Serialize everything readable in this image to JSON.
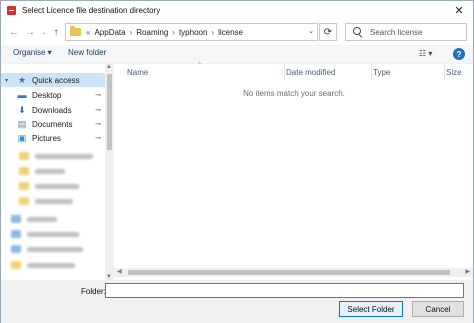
{
  "window": {
    "title": "Select Licence file destination directory",
    "close_glyph": "✕",
    "accent": "#d8302f"
  },
  "nav": {
    "back": "←",
    "forward": "→",
    "up": "↑",
    "refresh": "⟳",
    "overflow": "«",
    "breadcrumbs": [
      "AppData",
      "Roaming",
      "typhoon",
      "license"
    ],
    "separator": "›",
    "dropdown": "⌄"
  },
  "search": {
    "placeholder": "Search license"
  },
  "toolbar": {
    "organise_label": "Organise ▾",
    "new_folder_label": "New folder",
    "view_label": "☷ ▾",
    "help_label": "?"
  },
  "sidebar": {
    "quick_access": "Quick access",
    "items": [
      {
        "label": "Desktop",
        "icon": "desktop-icon",
        "color": "#2b78d0"
      },
      {
        "label": "Downloads",
        "icon": "downloads-icon",
        "color": "#2b78d0"
      },
      {
        "label": "Documents",
        "icon": "documents-icon",
        "color": "#6a7f99"
      },
      {
        "label": "Pictures",
        "icon": "pictures-icon",
        "color": "#2b8ed6"
      }
    ],
    "pin_glyph": "📌"
  },
  "file_list": {
    "columns": [
      "Name",
      "Date modified",
      "Type",
      "Size"
    ],
    "sort_indicator": "^",
    "empty_message": "No items match your search."
  },
  "bottom": {
    "folder_label": "Folder:",
    "folder_value": "",
    "select_button": "Select Folder",
    "cancel_button": "Cancel"
  }
}
